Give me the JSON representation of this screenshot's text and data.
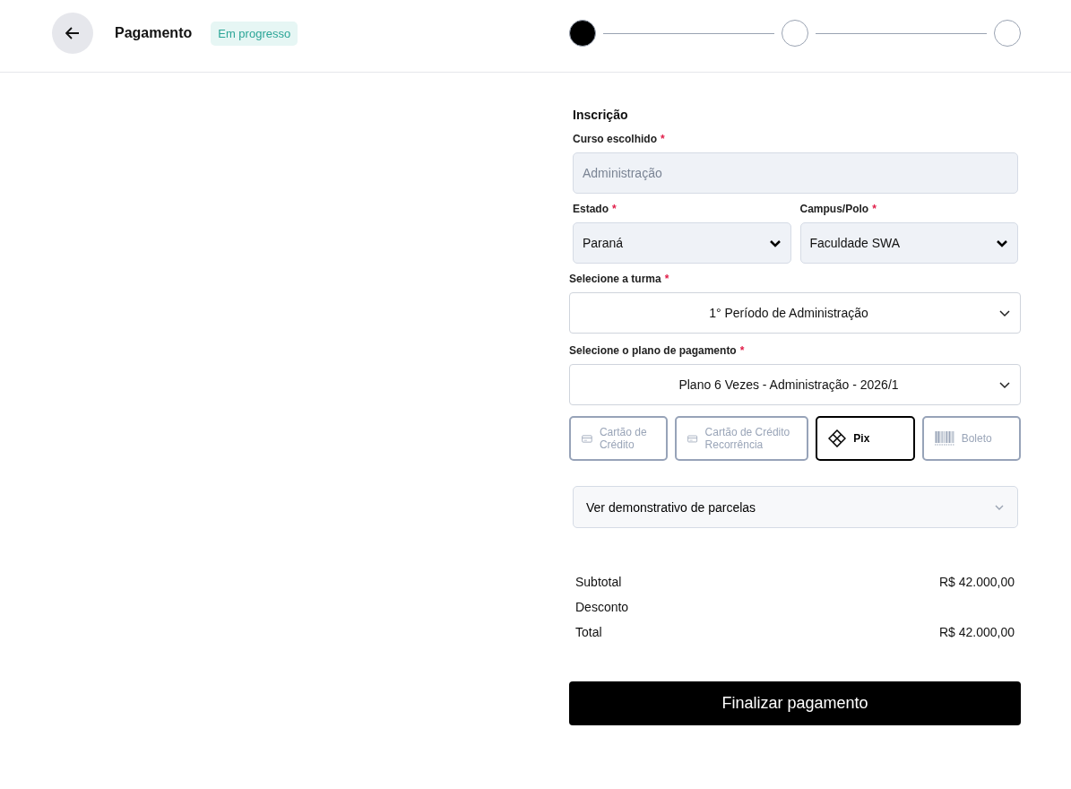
{
  "header": {
    "title": "Pagamento",
    "status_badge": "Em progresso"
  },
  "stepper": [
    {
      "active": true
    },
    {
      "active": false
    },
    {
      "active": false
    }
  ],
  "form": {
    "section_title": "Inscrição",
    "course": {
      "label": "Curso escolhido",
      "required_mark": "*",
      "value": "Administração",
      "disabled": true
    },
    "state": {
      "label": "Estado",
      "required_mark": "*",
      "value": "Paraná"
    },
    "campus": {
      "label": "Campus/Polo",
      "required_mark": "*",
      "value": "Faculdade SWA"
    },
    "class": {
      "label": "Selecione a turma",
      "required_mark": "*",
      "value": "1° Período de Administração"
    },
    "plan": {
      "label": "Selecione o plano de pagamento",
      "required_mark": "*",
      "value": "Plano 6 Vezes - Administração - 2026/1"
    },
    "payment_methods": [
      {
        "kind": "card",
        "label": "Cartão de Crédito",
        "selected": false
      },
      {
        "kind": "card",
        "label": "Cartão de Crédito Recorrência",
        "selected": false
      },
      {
        "kind": "pix",
        "label": "Pix",
        "selected": true
      },
      {
        "kind": "barcode",
        "label": "Boleto",
        "selected": false
      }
    ],
    "installments": {
      "label": "Ver demonstrativo de parcelas",
      "expanded": false
    }
  },
  "summary": [
    {
      "label": "Subtotal",
      "value": "R$ 42.000,00"
    },
    {
      "label": "Desconto"
    },
    {
      "label": "Total",
      "value": "R$ 42.000,00"
    }
  ],
  "submit_button": "Finalizar pagamento"
}
